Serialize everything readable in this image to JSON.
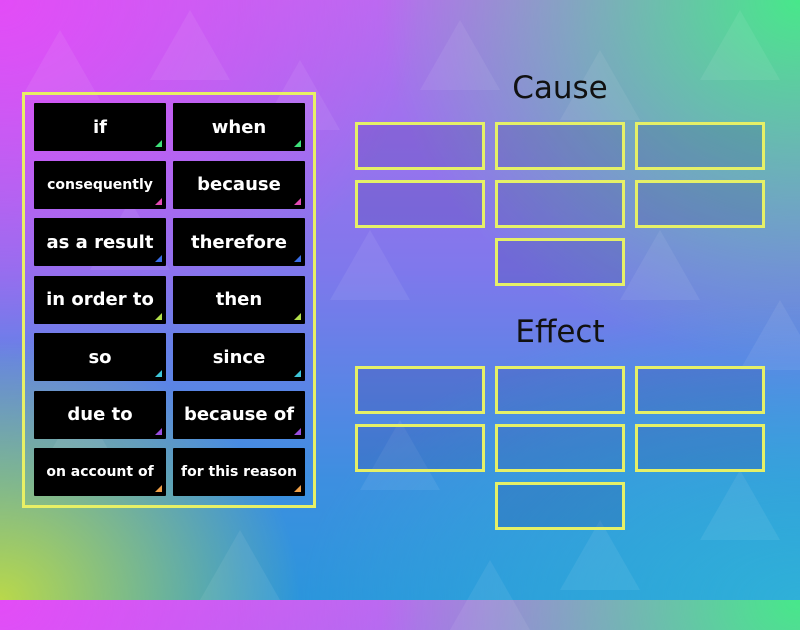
{
  "word_bank": {
    "tiles": [
      {
        "label": "if",
        "color": "#3ee07a"
      },
      {
        "label": "when",
        "color": "#3ee07a"
      },
      {
        "label": "consequently",
        "color": "#e24bb4"
      },
      {
        "label": "because",
        "color": "#e24bb4"
      },
      {
        "label": "as a result",
        "color": "#3a6ee8"
      },
      {
        "label": "therefore",
        "color": "#3a6ee8"
      },
      {
        "label": "in order to",
        "color": "#b2e04a"
      },
      {
        "label": "then",
        "color": "#b2e04a"
      },
      {
        "label": "so",
        "color": "#3ec6d8"
      },
      {
        "label": "since",
        "color": "#3ec6d8"
      },
      {
        "label": "due to",
        "color": "#9a4ee0"
      },
      {
        "label": "because of",
        "color": "#9a4ee0"
      },
      {
        "label": "on account of",
        "color": "#f0a048"
      },
      {
        "label": "for this reason",
        "color": "#f0a048"
      }
    ]
  },
  "groups": [
    {
      "title": "Cause",
      "slot_count": 7
    },
    {
      "title": "Effect",
      "slot_count": 7
    }
  ],
  "colors": {
    "border": "#e8f065",
    "tile_bg": "#000000"
  }
}
